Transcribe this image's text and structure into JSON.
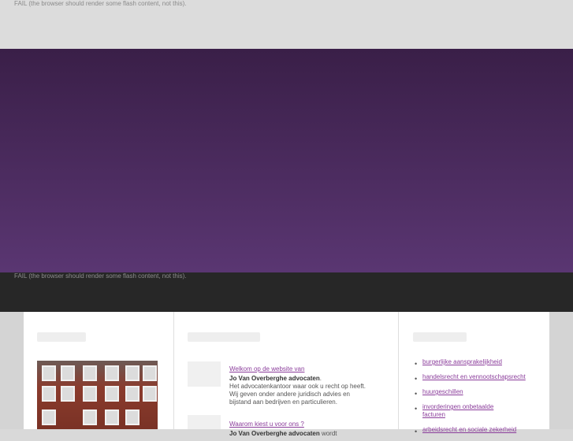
{
  "flash_fail_text": "FAIL (the browser should render some flash content, not this).",
  "welcome": {
    "link": "Welkom op de website van",
    "firm": "Jo Van Overberghe advocaten",
    "period": ".",
    "body": "Het advocatenkantoor waar ook u recht op heeft. Wij geven onder andere juridisch advies en bijstand aan bedrijven en particulieren."
  },
  "why": {
    "link": "Waarom kiest u voor ons ?",
    "firm": "Jo Van Overberghe advocaten",
    "tail": "wordt"
  },
  "services": [
    "burgerlijke aansprakelijkheid",
    "handelsrecht en vennootschapsrecht",
    "huurgeschillen",
    "invorderingen onbetaalde facturen",
    "arbeidsrecht en sociale zekerheid"
  ]
}
